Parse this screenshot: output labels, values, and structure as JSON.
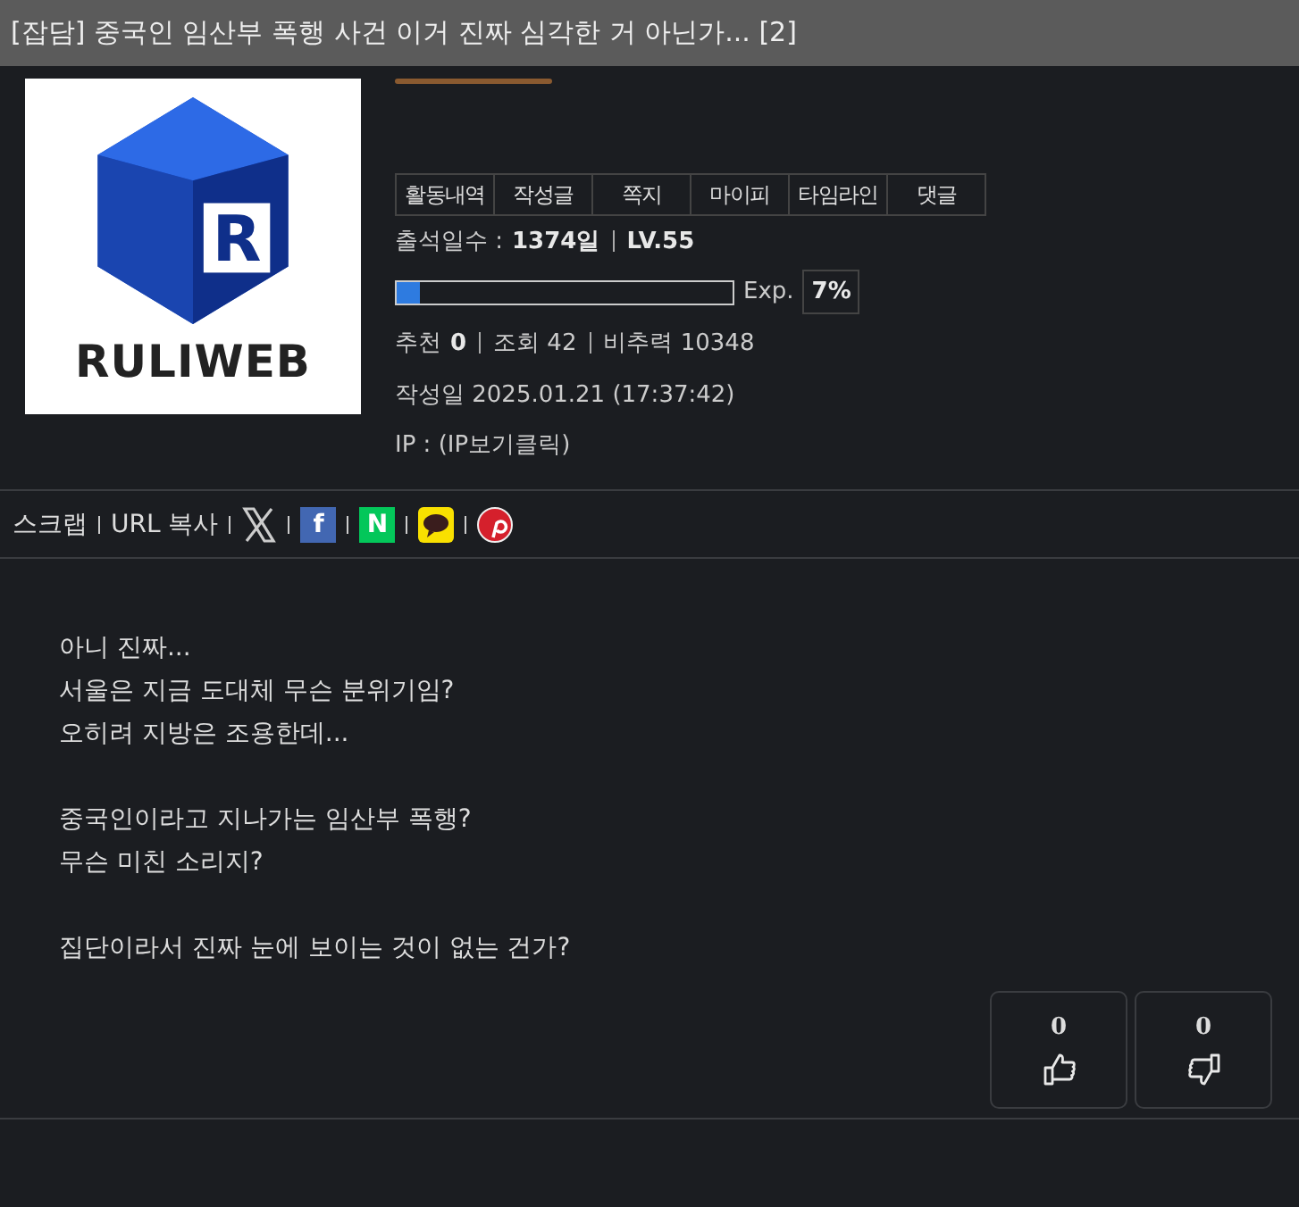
{
  "title": "[잡담] 중국인 임산부 폭행 사건 이거 진짜 심각한 거 아닌가... [2]",
  "profile": {
    "logo_letter": "R",
    "logo_text": "RULIWEB",
    "tabs": [
      "활동내역",
      "작성글",
      "쪽지",
      "마이피",
      "타임라인",
      "댓글"
    ],
    "attendance_label": "출석일수 :",
    "attendance_value": "1374일",
    "level": "LV.55",
    "exp": {
      "level": 0.07,
      "label": "Exp.",
      "percent": "7%"
    },
    "recommend_label": "추천",
    "recommend_value": "0",
    "views": "조회 42",
    "nonrec": "비추력 10348",
    "date": "작성일 2025.01.21 (17:37:42)",
    "ip": "IP : (IP보기클릭)"
  },
  "share": {
    "links": [
      "스크랩",
      "URL 복사"
    ],
    "icons": [
      {
        "kind": "x"
      },
      {
        "kind": "facebook",
        "glyph": "f"
      },
      {
        "kind": "naver",
        "glyph": "N"
      },
      {
        "kind": "kakao"
      },
      {
        "kind": "pinterest"
      }
    ]
  },
  "body": [
    [
      "아니 진짜...",
      "서울은 지금 도대체 무슨 분위기임?",
      "오히려 지방은 조용한데..."
    ],
    [
      "중국인이라고 지나가는 임산부 폭행?",
      "무슨 미친 소리지?"
    ],
    [
      "집단이라서 진짜 눈에 보이는 것이 없는 건가?"
    ]
  ],
  "votes": [
    {
      "kind": "up",
      "count": "0"
    },
    {
      "kind": "down",
      "count": "0"
    }
  ]
}
